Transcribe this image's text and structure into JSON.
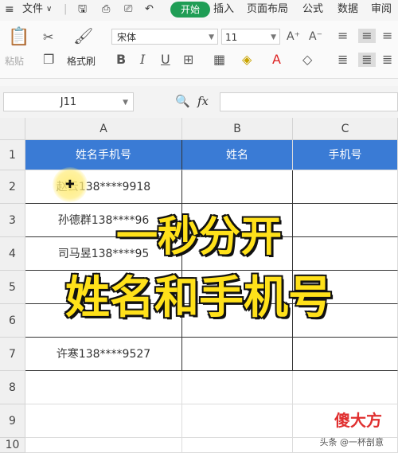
{
  "menu": {
    "file": "文件",
    "tabs": [
      "插入",
      "页面布局",
      "公式",
      "数据",
      "审阅"
    ],
    "active_tab": "开始"
  },
  "ribbon": {
    "paste": "粘贴",
    "format_painter": "格式刷",
    "font_name": "宋体",
    "font_size": "11",
    "bold": "B",
    "italic": "I",
    "underline": "U",
    "font_color_letter": "A"
  },
  "formula_bar": {
    "cell_ref": "J11",
    "fx": "fx",
    "content": ""
  },
  "columns": [
    "A",
    "B",
    "C"
  ],
  "rows": [
    "1",
    "2",
    "3",
    "4",
    "5",
    "6",
    "7",
    "8",
    "9",
    "10"
  ],
  "table": {
    "headers": [
      "姓名手机号",
      "姓名",
      "手机号"
    ],
    "data": [
      "赵云138****9918",
      "孙德群138****96",
      "司马昱138****95",
      "",
      "",
      "许寒138****9527"
    ]
  },
  "overlay": {
    "line1": "一秒分开",
    "line2": "姓名和手机号"
  },
  "watermark": {
    "brand": "傻大方",
    "sub": "头条 @一杯剖意"
  },
  "colors": {
    "header_fill": "#3a7bd5",
    "overlay_text": "#ffe11a",
    "active_tab": "#1f9d55"
  }
}
